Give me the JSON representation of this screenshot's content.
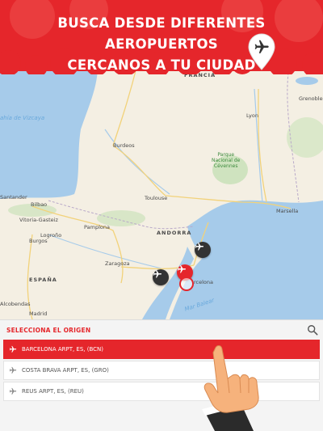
{
  "banner": {
    "headline_line1": "BUSCA DESDE DIFERENTES AEROPUERTOS",
    "headline_line2": "CERCANOS A TU CIUDAD",
    "color": "#e5262b"
  },
  "map": {
    "labels": {
      "francia": "FRANCIA",
      "espana": "ESPAÑA",
      "andorra": "ANDORRA",
      "golfo": "ahía de Vizcaya",
      "mar_balear": "Mar Balear",
      "bordeaux": "Burdeos",
      "lyon": "Lyon",
      "grenoble": "Grenoble",
      "toulouse": "Toulouse",
      "marseille": "Marsella",
      "bilbao": "Bilbao",
      "santander": "Santander",
      "vitoria": "Vitoria-Gasteiz",
      "logrono": "Logroño",
      "burgos": "Burgos",
      "pamplona": "Pamplona",
      "zaragoza": "Zaragoza",
      "barcelona": "rcelona",
      "alcobendas": "Alcobendas",
      "madrid": "Madrid",
      "park": "Parque\nNacional de\nCévennes"
    },
    "markers": [
      {
        "name": "reus",
        "icon": "airplane-icon",
        "active": false
      },
      {
        "name": "barcelona",
        "icon": "airplane-icon",
        "active": true
      },
      {
        "name": "girona",
        "icon": "airplane-icon",
        "active": false
      }
    ]
  },
  "panel": {
    "header": "SELECCIONA EL ORIGEN",
    "search_icon": "search-icon",
    "items": [
      {
        "label": "BARCELONA ARPT, ES, (BCN)",
        "selected": true
      },
      {
        "label": "COSTA BRAVA ARPT, ES, (GRO)",
        "selected": false
      },
      {
        "label": "REUS ARPT, ES, (REU)",
        "selected": false
      }
    ]
  }
}
